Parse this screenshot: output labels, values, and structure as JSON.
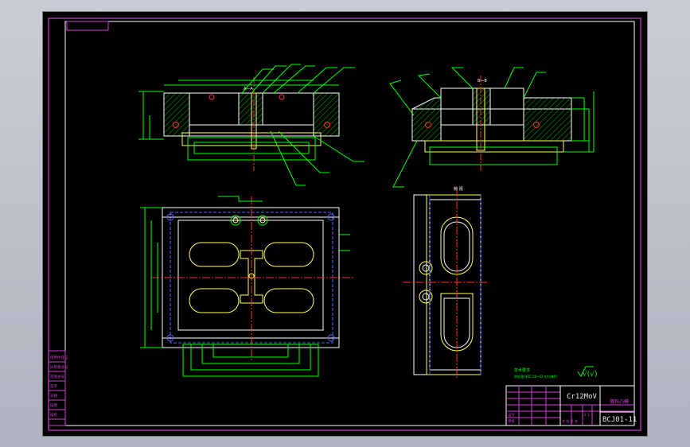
{
  "colors": {
    "border": "#d040d0",
    "outline": "#ffffff",
    "part": "#ffff66",
    "dimension": "#00ff00",
    "centerline": "#ff3030",
    "hidden": "#6060ff",
    "hatch": "#00b000"
  },
  "drawing": {
    "title": "落料凸模",
    "material": "Cr12MoV",
    "number": "BCJ01-11",
    "roughness": "√(√)",
    "section_front": "A—A",
    "section_side": "B—B",
    "view_label": "俯 视"
  },
  "technical_requirements": {
    "heading": "技术要求",
    "note": "热处理 HRC 58~62 刃口锋利"
  },
  "title_block": {
    "scale": "1:1",
    "sheet": "共 张 第 张",
    "designer_label": "设计",
    "checker_label": "审核"
  },
  "side_labels": [
    "借用件登记",
    "旧底图总号",
    "底图总号",
    "签字",
    "日期",
    "描图",
    "描校"
  ]
}
